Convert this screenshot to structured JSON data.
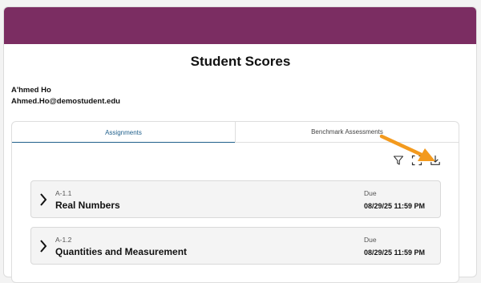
{
  "page": {
    "title": "Student Scores"
  },
  "student": {
    "name": "A'hmed Ho",
    "email": "Ahmed.Ho@demostudent.edu"
  },
  "tabs": [
    {
      "label": "Assignments",
      "active": true
    },
    {
      "label": "Benchmark Assessments",
      "active": false
    }
  ],
  "toolbar": {
    "icons": [
      "filter-icon",
      "fullscreen-icon",
      "download-icon"
    ]
  },
  "assignments": [
    {
      "code": "A-1.1",
      "title": "Real Numbers",
      "due_label": "Due",
      "due_date": "08/29/25 11:59 PM"
    },
    {
      "code": "A-1.2",
      "title": "Quantities and Measurement",
      "due_label": "Due",
      "due_date": "08/29/25 11:59 PM"
    }
  ],
  "colors": {
    "banner": "#7b2d62",
    "active_tab": "#1f5f8b",
    "annotation_arrow": "#f39a1e"
  }
}
